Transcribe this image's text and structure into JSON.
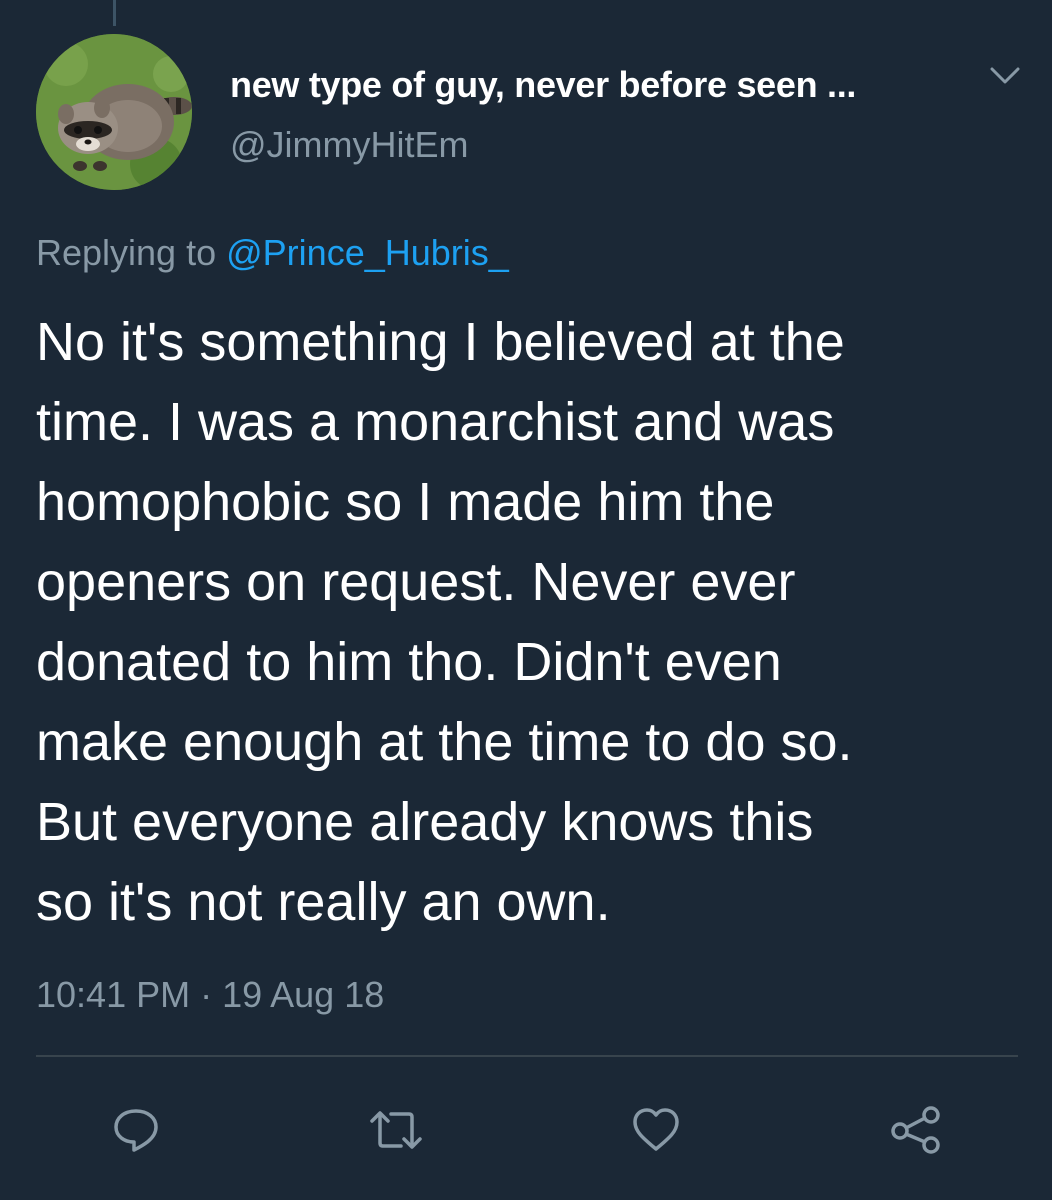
{
  "author": {
    "display_name": "new type of guy, never before seen ...",
    "handle": "@JimmyHitEm",
    "avatar_icon": "raccoon-avatar"
  },
  "reply": {
    "prefix": "Replying to",
    "mention": "@Prince_Hubris_"
  },
  "tweet": {
    "lines": [
      "No it's something I believed at the",
      "time. I was a monarchist and was",
      "homophobic so I made him the",
      "openers on request. Never ever",
      "donated to him tho. Didn't even",
      "make enough at the time to do so.",
      "But everyone already knows this",
      "so it's not really an own."
    ],
    "timestamp": "10:41 PM · 19 Aug 18"
  },
  "actions": [
    {
      "name": "reply",
      "icon": "speech-bubble-icon"
    },
    {
      "name": "retweet",
      "icon": "retweet-icon"
    },
    {
      "name": "like",
      "icon": "heart-icon"
    },
    {
      "name": "share",
      "icon": "share-icon"
    }
  ],
  "colors": {
    "background": "#1b2836",
    "text": "#ffffff",
    "secondary_text": "#8899a6",
    "link": "#1da1f2",
    "divider": "#38444d"
  }
}
